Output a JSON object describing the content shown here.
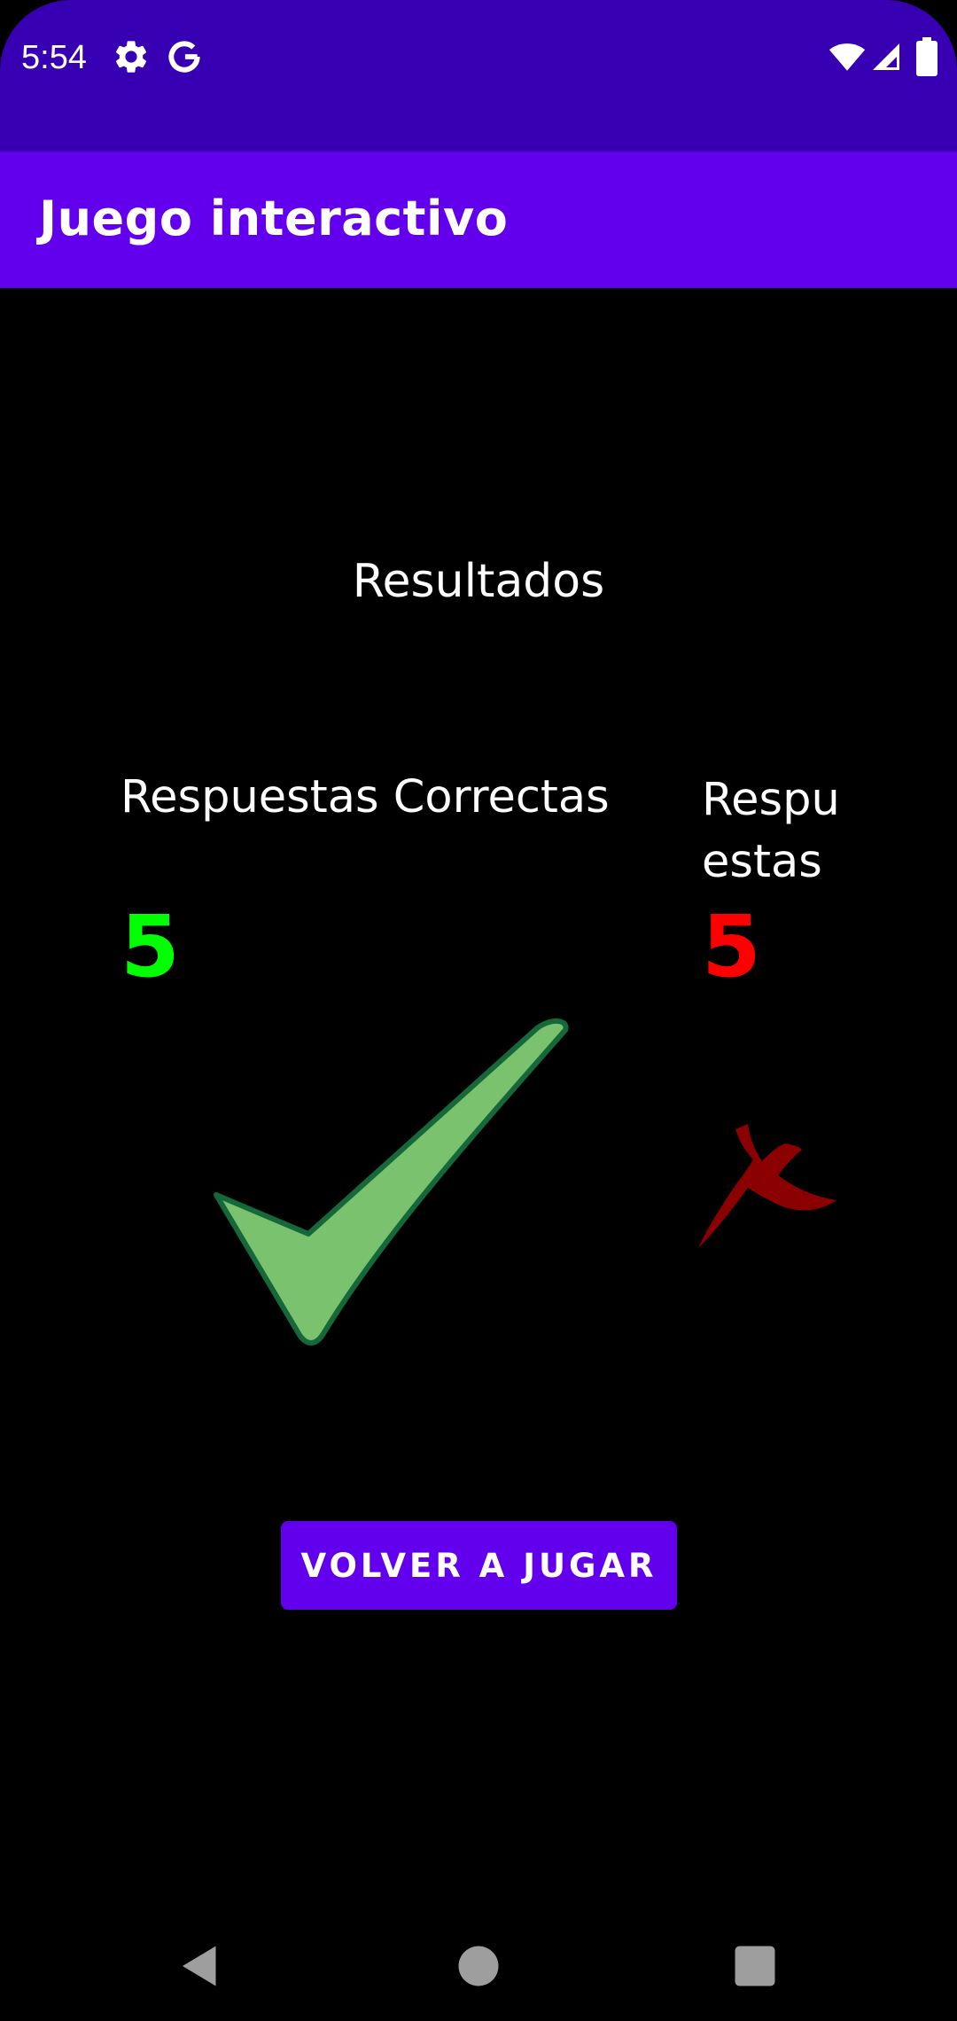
{
  "status_bar": {
    "time": "5:54",
    "icons_left": [
      "gear-icon",
      "google-icon"
    ],
    "icons_right": [
      "wifi-icon",
      "cell-signal-icon",
      "battery-icon"
    ],
    "background": "#3700B3"
  },
  "app_bar": {
    "title": "Juego interactivo",
    "background": "#6200EE"
  },
  "results": {
    "title": "Resultados",
    "correct": {
      "label": "Respuestas Correctas",
      "count": "5",
      "color": "#00ff00",
      "icon": "checkmark-icon"
    },
    "incorrect": {
      "label": "Respuestas",
      "count": "5",
      "color": "#ff0000",
      "icon": "cross-icon"
    }
  },
  "button": {
    "label": "VOLVER A JUGAR",
    "color": "#6200EE"
  },
  "navigation": {
    "items": [
      "back-icon",
      "home-icon",
      "recents-icon"
    ]
  }
}
